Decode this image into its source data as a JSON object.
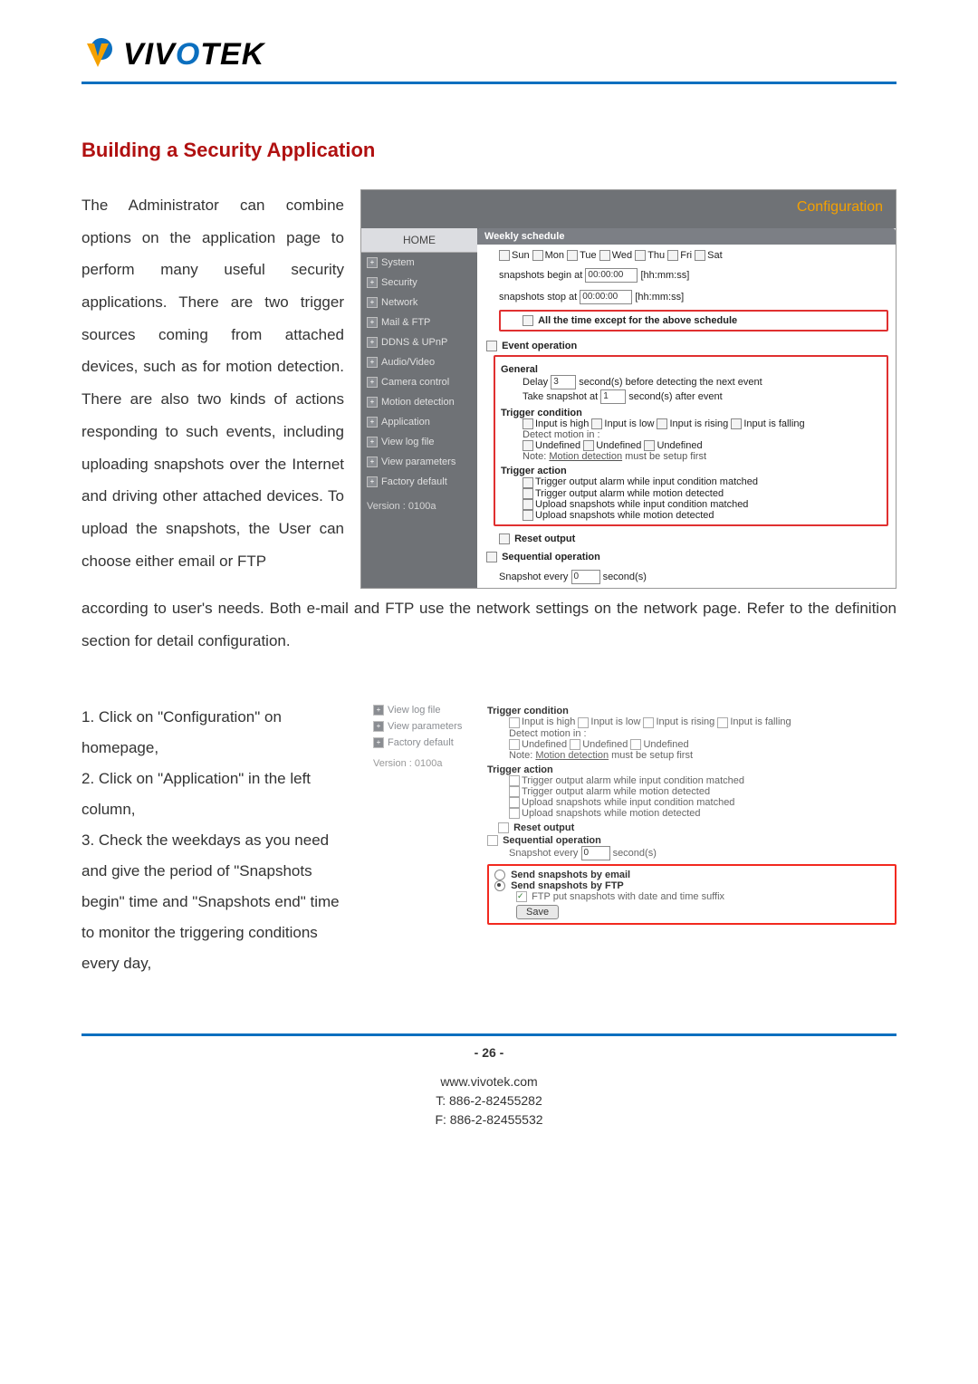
{
  "brand": "VIVOTEK",
  "heading": "Building a Security Application",
  "paragraph_main": "The Administrator can combine options on the application page to perform many useful security applications. There are two trigger sources coming from attached devices, such as for motion detection. There are also two kinds of actions responding to such events, including uploading snapshots over the Internet and driving other attached devices. To upload the snapshots, the User can choose either email or FTP",
  "paragraph_after": "according to user's needs. Both e-mail and FTP use the network settings on the network page. Refer to the definition section for detail configuration.",
  "fig1": {
    "titlebar": "Configuration",
    "home": "HOME",
    "nav": [
      "System",
      "Security",
      "Network",
      "Mail & FTP",
      "DDNS & UPnP",
      "Audio/Video",
      "Camera control",
      "Motion detection",
      "Application",
      "View log file",
      "View parameters",
      "Factory default"
    ],
    "version": "Version : 0100a",
    "weekly": {
      "title": "Weekly schedule",
      "days": [
        "Sun",
        "Mon",
        "Tue",
        "Wed",
        "Thu",
        "Fri",
        "Sat"
      ],
      "begin_label": "snapshots begin at",
      "begin_val": "00:00:00",
      "stop_label": "snapshots stop at",
      "stop_val": "00:00:00",
      "hhmmss": "[hh:mm:ss]",
      "all_time": "All the time except for the above schedule"
    },
    "event": {
      "title": "Event operation",
      "general": "General",
      "delay_pre": "Delay",
      "delay_val": "3",
      "delay_post": "second(s) before detecting the next event",
      "snap_pre": "Take snapshot at",
      "snap_val": "1",
      "snap_post": "second(s) after event",
      "trig_cond": "Trigger condition",
      "inputs": [
        "Input is high",
        "Input is low",
        "Input is rising",
        "Input is falling"
      ],
      "detect_in": "Detect motion in :",
      "undef": "Undefined",
      "note_pre": "Note:",
      "note_link": "Motion detection",
      "note_post": "must be setup first",
      "trig_action": "Trigger action",
      "actions": [
        "Trigger output alarm while input condition matched",
        "Trigger output alarm while motion detected",
        "Upload snapshots while input condition matched",
        "Upload snapshots while motion detected"
      ],
      "reset": "Reset output"
    },
    "seq": {
      "title": "Sequential operation",
      "snap_every": "Snapshot every",
      "snap_val": "0",
      "snap_unit": "second(s)"
    }
  },
  "instructions": [
    "1. Click on \"Configuration\" on homepage,",
    "2. Click on \"Application\" in the left column,",
    "3. Check the weekdays as you need and give the period of \"Snapshots begin\" time and \"Snapshots end\" time to monitor the triggering conditions every day,"
  ],
  "fig2": {
    "nav": [
      "View log file",
      "View parameters",
      "Factory default"
    ],
    "version": "Version : 0100a",
    "trig_cond": "Trigger condition",
    "inputs": [
      "Input is high",
      "Input is low",
      "Input is rising",
      "Input is falling"
    ],
    "detect_in": "Detect motion in :",
    "undef": "Undefined",
    "note_pre": "Note:",
    "note_link": "Motion detection",
    "note_post": "must be setup first",
    "trig_action": "Trigger action",
    "actions": [
      "Trigger output alarm while input condition matched",
      "Trigger output alarm while motion detected",
      "Upload snapshots while input condition matched",
      "Upload snapshots while motion detected"
    ],
    "reset": "Reset output",
    "seq_title": "Sequential operation",
    "snap_every": "Snapshot every",
    "snap_val": "0",
    "snap_unit": "second(s)",
    "send_email": "Send snapshots by email",
    "send_ftp": "Send snapshots by FTP",
    "ftp_suffix": "FTP put snapshots with date and time suffix",
    "save": "Save"
  },
  "page_number": "- 26 -",
  "footer": {
    "url": "www.vivotek.com",
    "tel": "T: 886-2-82455282",
    "fax": "F: 886-2-82455532"
  }
}
